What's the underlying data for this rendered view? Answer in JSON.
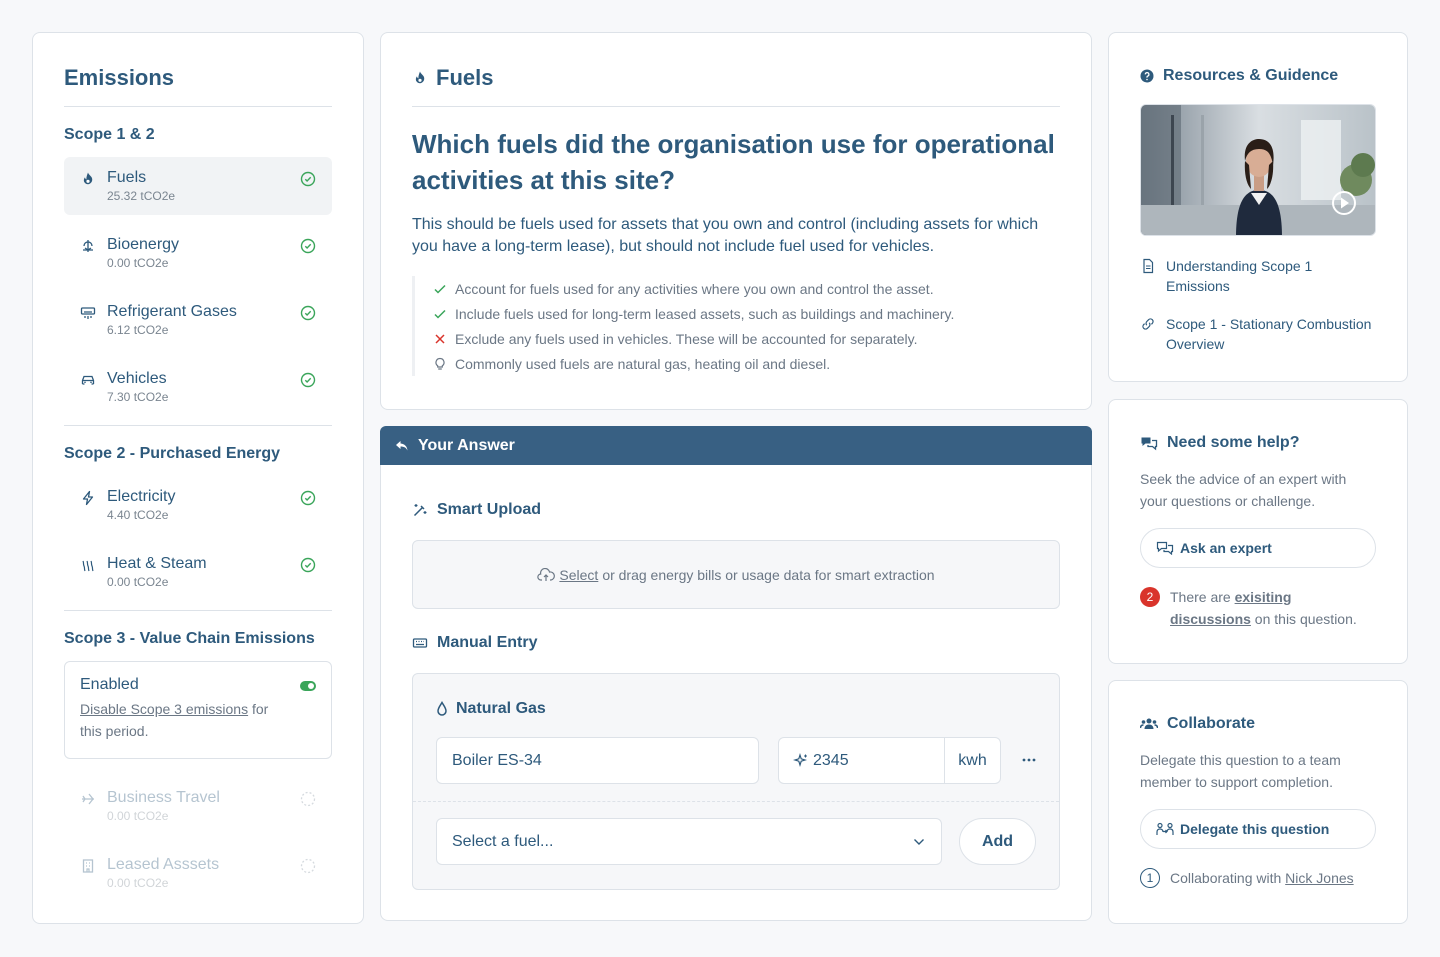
{
  "sidebar": {
    "title": "Emissions",
    "scope12_heading": "Scope 1 & 2",
    "scope12_items": [
      {
        "name": "Fuels",
        "value": "25.32 tCO2e"
      },
      {
        "name": "Bioenergy",
        "value": "0.00 tCO2e"
      },
      {
        "name": "Refrigerant Gases",
        "value": "6.12 tCO2e"
      },
      {
        "name": "Vehicles",
        "value": "7.30 tCO2e"
      }
    ],
    "scope2_heading": "Scope 2 - Purchased Energy",
    "scope2_items": [
      {
        "name": "Electricity",
        "value": "4.40 tCO2e"
      },
      {
        "name": "Heat & Steam",
        "value": "0.00 tCO2e"
      }
    ],
    "scope3_heading": "Scope 3 - Value Chain Emissions",
    "scope3_status": "Enabled",
    "scope3_link": "Disable Scope 3 emissions",
    "scope3_text_a": " for",
    "scope3_text_b": "this period.",
    "scope3_items": [
      {
        "name": "Business Travel",
        "value": "0.00 tCO2e"
      },
      {
        "name": "Leased Asssets",
        "value": "0.00 tCO2e"
      }
    ]
  },
  "question": {
    "section": "Fuels",
    "title": "Which fuels did the organisation use for operational activities at this site?",
    "description": "This should be fuels used for assets that you own and control (including assets for which you have a long-term lease), but should not include fuel used for vehicles.",
    "hints": [
      {
        "type": "check",
        "text": "Account for fuels used for any activities where you own and control the asset."
      },
      {
        "type": "check",
        "text": "Include fuels used for long-term leased assets, such as buildings and machinery."
      },
      {
        "type": "cross",
        "text": "Exclude any fuels used in vehicles. These will be accounted for separately."
      },
      {
        "type": "tip",
        "text": "Commonly used fuels are natural gas, heating oil and diesel."
      }
    ]
  },
  "answer": {
    "bar_title": "Your Answer",
    "smart_upload": "Smart Upload",
    "upload_link": "Select",
    "upload_text": "or drag energy bills or usage data for smart extraction",
    "manual_entry": "Manual Entry",
    "fuel_type": "Natural Gas",
    "asset_value": "Boiler ES-34",
    "amount_value": "2345",
    "unit": "kwh",
    "select_placeholder": "Select a fuel...",
    "add_label": "Add"
  },
  "resources": {
    "title": "Resources & Guidence",
    "links": [
      {
        "icon": "document-icon",
        "text": "Understanding Scope 1 Emissions"
      },
      {
        "icon": "link-icon",
        "text": "Scope 1 - Stationary Combustion Overview"
      }
    ]
  },
  "help": {
    "title": "Need some help?",
    "text": "Seek the advice of an expert with your questions or challenge.",
    "button": "Ask an expert",
    "badge_count": "2",
    "note_a": "There are ",
    "note_link": "exisiting discussions",
    "note_b": " on this question."
  },
  "collab": {
    "title": "Collaborate",
    "text": "Delegate this question to a team member to support completion.",
    "button": "Delegate this question",
    "badge_count": "1",
    "note_a": "Collaborating with ",
    "note_link": "Nick Jones"
  },
  "colors": {
    "primary": "#2e5a7c",
    "answer_bar": "#386083",
    "success": "#3aa55a",
    "danger": "#d9342b"
  }
}
